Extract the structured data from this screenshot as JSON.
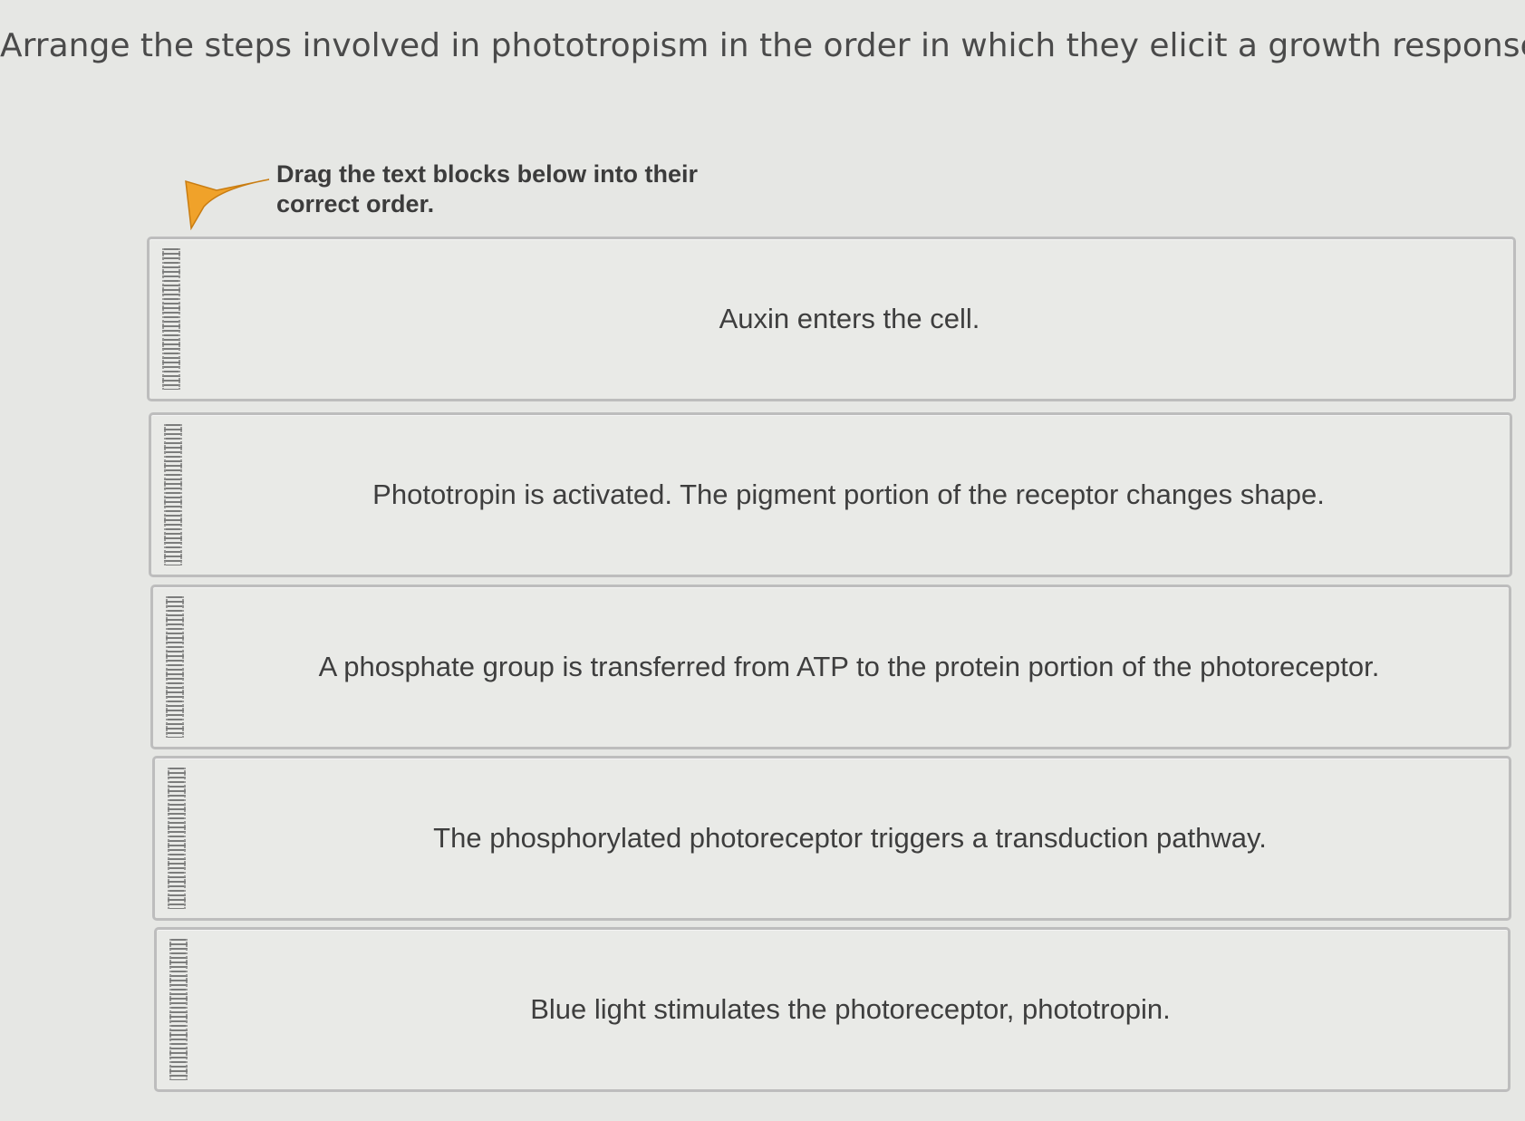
{
  "question": "Arrange the steps involved in phototropism in the order in which they elicit a growth response.",
  "instruction": "Drag the text blocks below into their correct order.",
  "icons": {
    "arrow": "orange-arrow-icon",
    "grip": "drag-handle-icon"
  },
  "colors": {
    "arrow": "#f0a22a",
    "block_border": "#bdbdbd",
    "background": "#e6e7e4"
  },
  "blocks": [
    {
      "label": "Auxin enters the cell."
    },
    {
      "label": "Phototropin is activated. The pigment portion of the receptor changes shape."
    },
    {
      "label": "A phosphate group is transferred from ATP to the protein portion of the photoreceptor."
    },
    {
      "label": "The phosphorylated photoreceptor triggers a transduction pathway."
    },
    {
      "label": "Blue light stimulates the photoreceptor, phototropin."
    }
  ]
}
